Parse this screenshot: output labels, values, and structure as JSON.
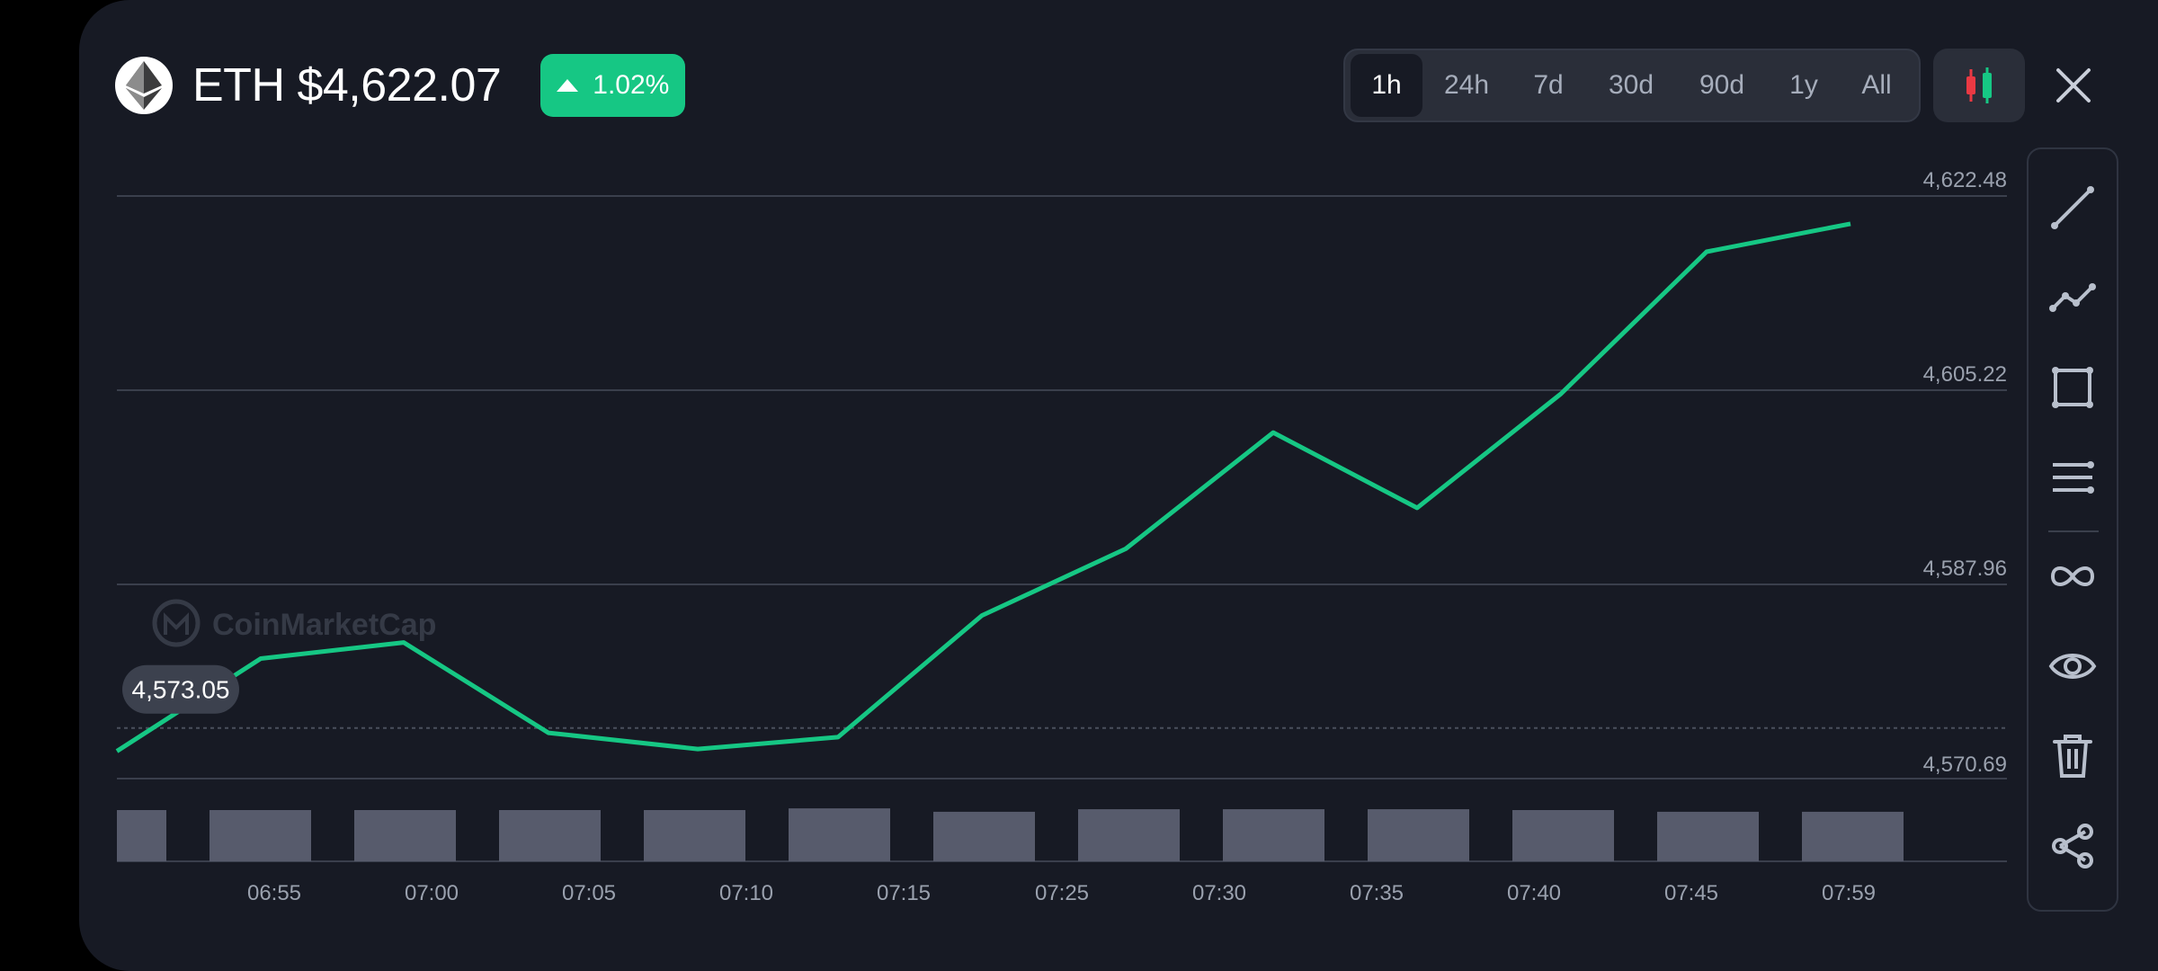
{
  "header": {
    "symbol_price": "ETH $4,622.07",
    "change": "1.02%",
    "change_direction": "up"
  },
  "ranges": [
    "1h",
    "24h",
    "7d",
    "30d",
    "90d",
    "1y",
    "All"
  ],
  "active_range": "1h",
  "colors": {
    "up": "#16c784",
    "line": "#16c784",
    "background": "#171a24",
    "volume": "#575b6c"
  },
  "watermark": "CoinMarketCap",
  "tools": [
    "trend-line-icon",
    "path-line-icon",
    "rectangle-icon",
    "parallel-lines-icon",
    "infinite-line-icon",
    "eye-icon",
    "trash-icon",
    "share-icon"
  ],
  "chart_data": {
    "type": "line",
    "y_ticks": [
      "4,622.48",
      "4,605.22",
      "4,587.96",
      "4,570.69"
    ],
    "ylim": [
      4570.69,
      4622.48
    ],
    "start_price_label": "4,573.05",
    "start_price": 4573.05,
    "x_labels": [
      "06:55",
      "07:00",
      "07:05",
      "07:10",
      "07:15",
      "07:25",
      "07:30",
      "07:35",
      "07:40",
      "07:45",
      "07:59"
    ],
    "series": [
      {
        "values": [
          4570.9,
          4579.5,
          4581.0,
          4572.6,
          4571.1,
          4572.2,
          4583.5,
          4589.7,
          4600.5,
          4593.5,
          4604.1,
          4617.3,
          4619.9
        ]
      }
    ],
    "volumes": [
      0.6,
      0.6,
      0.6,
      0.6,
      0.6,
      0.62,
      0.58,
      0.61,
      0.61,
      0.61,
      0.6,
      0.58,
      0.58
    ]
  }
}
